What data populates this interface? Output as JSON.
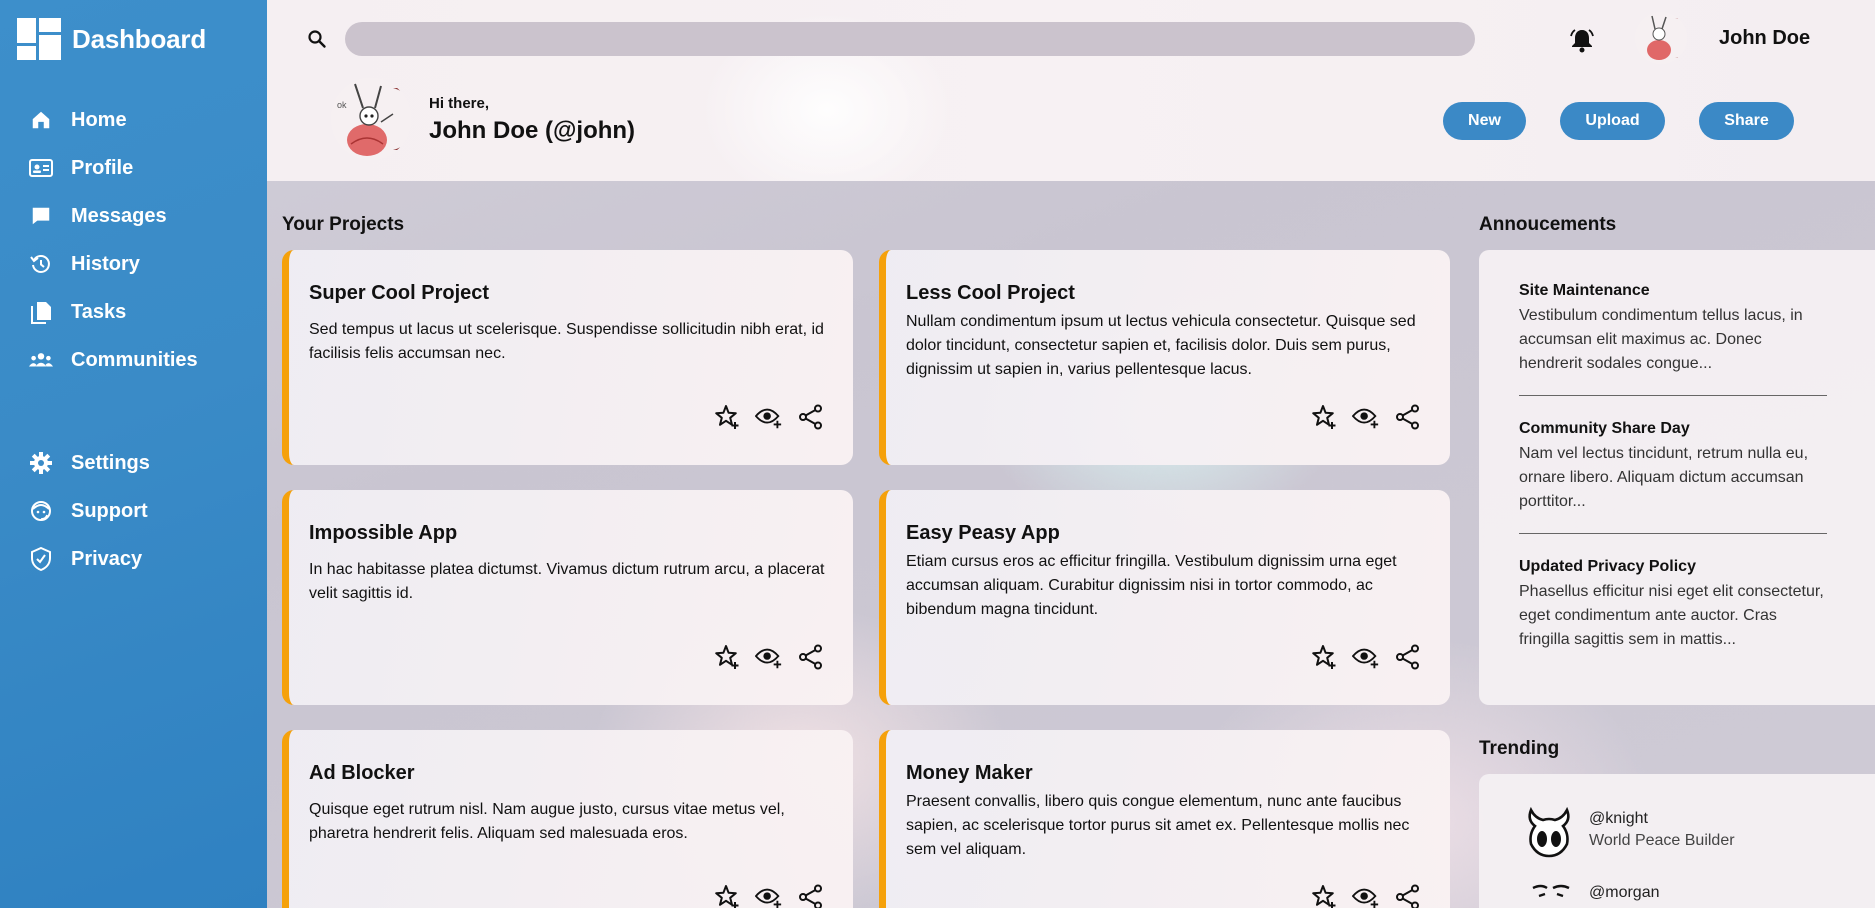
{
  "sidebar": {
    "brand": "Dashboard",
    "items": [
      {
        "label": "Home",
        "icon": "home-icon"
      },
      {
        "label": "Profile",
        "icon": "id-card-icon"
      },
      {
        "label": "Messages",
        "icon": "chat-icon"
      },
      {
        "label": "History",
        "icon": "history-icon"
      },
      {
        "label": "Tasks",
        "icon": "document-icon"
      },
      {
        "label": "Communities",
        "icon": "people-icon"
      }
    ],
    "bottom_items": [
      {
        "label": "Settings",
        "icon": "gear-icon"
      },
      {
        "label": "Support",
        "icon": "support-icon"
      },
      {
        "label": "Privacy",
        "icon": "shield-icon"
      }
    ]
  },
  "header": {
    "search": {
      "value": "",
      "placeholder": ""
    },
    "username": "John Doe",
    "greeting": "Hi there,",
    "display_name": "John Doe (@john)",
    "buttons": {
      "new": "New",
      "upload": "Upload",
      "share": "Share"
    }
  },
  "projects": {
    "title": "Your Projects",
    "items": [
      {
        "title": "Super Cool Project",
        "desc": "Sed tempus ut lacus ut scelerisque. Suspendisse sollicitudin nibh erat, id facilisis felis accumsan nec."
      },
      {
        "title": "Less Cool Project",
        "desc": "Nullam condimentum ipsum ut lectus vehicula consectetur. Quisque sed dolor tincidunt, consectetur sapien et, facilisis dolor. Duis sem purus, dignissim ut sapien in, varius pellentesque lacus."
      },
      {
        "title": "Impossible App",
        "desc": "In hac habitasse platea dictumst. Vivamus dictum rutrum arcu, a placerat velit sagittis id."
      },
      {
        "title": "Easy Peasy App",
        "desc": "Etiam cursus eros ac efficitur fringilla. Vestibulum dignissim urna eget accumsan aliquam. Curabitur dignissim nisi in tortor commodo, ac bibendum magna tincidunt."
      },
      {
        "title": "Ad Blocker",
        "desc": "Quisque eget rutrum nisl. Nam augue justo, cursus vitae metus vel, pharetra hendrerit felis. Aliquam sed malesuada eros."
      },
      {
        "title": "Money Maker",
        "desc": "Praesent convallis, libero quis congue elementum, nunc ante faucibus sapien, ac scelerisque tortor purus sit amet ex. Pellentesque mollis nec sem vel aliquam."
      }
    ]
  },
  "announcements": {
    "title": "Annoucements",
    "items": [
      {
        "title": "Site Maintenance",
        "body": "Vestibulum condimentum tellus lacus, in accumsan elit maximus ac. Donec hendrerit sodales congue..."
      },
      {
        "title": "Community Share Day",
        "body": "Nam vel lectus tincidunt, retrum nulla eu, ornare libero. Aliquam dictum accumsan porttitor..."
      },
      {
        "title": "Updated Privacy Policy",
        "body": "Phasellus efficitur nisi eget elit consectetur, eget condimentum ante auctor. Cras fringilla sagittis sem in mattis..."
      }
    ]
  },
  "trending": {
    "title": "Trending",
    "items": [
      {
        "handle": "@knight",
        "role": "World Peace Builder"
      },
      {
        "handle": "@morgan",
        "role": ""
      }
    ]
  },
  "colors": {
    "sidebar": "#3a8bc7",
    "accent_button": "#3b89c6",
    "card_border": "#f5a10b"
  }
}
